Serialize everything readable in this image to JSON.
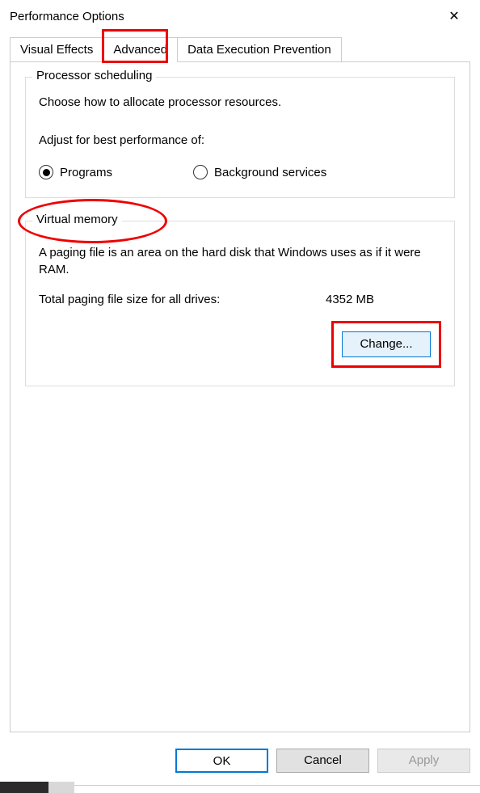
{
  "window": {
    "title": "Performance Options"
  },
  "tabs": {
    "visual_effects": "Visual Effects",
    "advanced": "Advanced",
    "data_execution": "Data Execution Prevention"
  },
  "processor": {
    "title": "Processor scheduling",
    "description": "Choose how to allocate processor resources.",
    "adjust_label": "Adjust for best performance of:",
    "option_programs": "Programs",
    "option_background": "Background services",
    "selected": "Programs"
  },
  "virtual_memory": {
    "title": "Virtual memory",
    "description": "A paging file is an area on the hard disk that Windows uses as if it were RAM.",
    "total_label": "Total paging file size for all drives:",
    "total_value": "4352 MB",
    "change_button": "Change..."
  },
  "dialog": {
    "ok": "OK",
    "cancel": "Cancel",
    "apply": "Apply"
  }
}
